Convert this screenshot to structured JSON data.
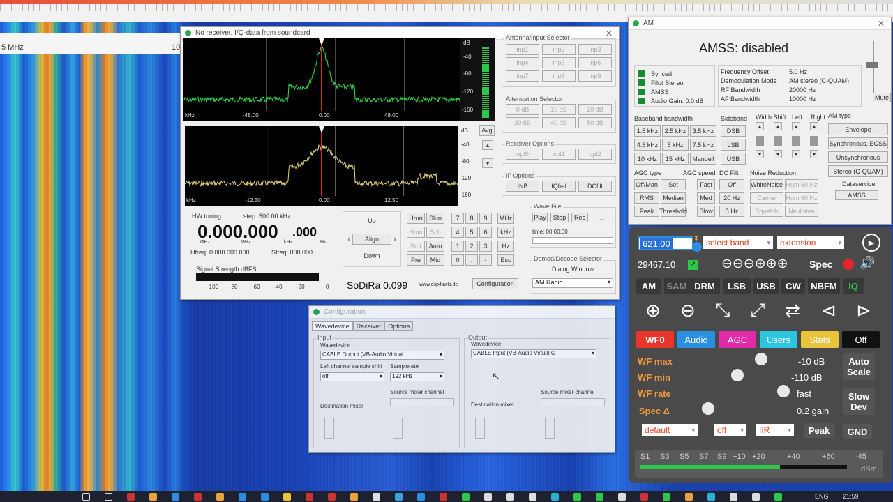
{
  "waterfall": {
    "scale_label": "5 MHz",
    "scale_label_right": "10"
  },
  "receiver": {
    "title": "No receiver, I/Q-data from soundcard",
    "top_spectrum": {
      "unit": "dB",
      "db_ticks": [
        "-40",
        "-80",
        "-120",
        "-160"
      ],
      "x_unit": "kHz",
      "x_ticks": [
        "-48.00",
        "0.00",
        "48.00"
      ]
    },
    "bottom_spectrum": {
      "unit": "dB",
      "db_ticks": [
        "-40",
        "-80",
        "-120",
        "-160"
      ],
      "x_unit": "kHz",
      "x_ticks": [
        "-12.50",
        "0.00",
        "12.50"
      ]
    },
    "avg_label": "Avg",
    "hw_tuning_label": "HW tuning",
    "step_label": "step: 500.00 kHz",
    "frequency_display": "0.000.000",
    "frequency_small": ".000",
    "freq_units": [
      "GHz",
      "MHz",
      "kHz",
      "Hz"
    ],
    "hfreq_label": "Hfreq: 0.000.000.000",
    "sfreq_label": "Sfreq: 000.000",
    "signal_strength_label": "Signal Strength dBFS",
    "signal_ticks": [
      "-100",
      "-80",
      "-60",
      "-40",
      "-20",
      "0"
    ],
    "nav": {
      "up": "Up",
      "align": "Align",
      "down": "Down"
    },
    "mode_buttons": [
      "Hrun",
      "Slun",
      "Hmo",
      "Sch",
      "Smt",
      "Auto",
      "Pre",
      "Mid"
    ],
    "keypad": [
      "7",
      "8",
      "9",
      "MHz",
      "4",
      "5",
      "6",
      "kHz",
      "1",
      "2",
      "3",
      "Hz",
      "0",
      ".",
      "-",
      "Esc"
    ],
    "app_name": "SoDiRa 0.099",
    "website": "www.dsp4swls.de",
    "config_button": "Configuration",
    "antenna_selector": {
      "label": "Antenna/Input Selector",
      "items": [
        "inp1",
        "inp2",
        "inp3",
        "inp4",
        "inp5",
        "inp6",
        "inp7",
        "inp8",
        "inp9"
      ]
    },
    "attenuation_selector": {
      "label": "Attenuation Selector",
      "items": [
        "0 dB",
        "10 dB",
        "20 dB",
        "30 dB",
        "40 dB",
        "50 dB"
      ]
    },
    "receiver_options": {
      "label": "Receiver Options",
      "items": [
        "opt0",
        "opt1",
        "opt2"
      ]
    },
    "if_options": {
      "label": "IF Options",
      "items": [
        "INB",
        "IQbal",
        "DCfilt"
      ]
    },
    "wave_file": {
      "label": "Wave File",
      "play": "Play",
      "stop": "Stop",
      "rec": "Rec",
      "extra": "...",
      "time": "time: 00:00:00"
    },
    "demod_selector": {
      "label": "Demod/Decode Selector",
      "dialog_button": "Dialog Window",
      "selected": "AM Radio"
    }
  },
  "am": {
    "title": "AM",
    "amss_status": "AMSS: disabled",
    "mute_label": "Mute",
    "leds": [
      "Synced",
      "Pilot Stereo",
      "AMSS",
      "Audio Gain: 0.0 dB"
    ],
    "info_labels": [
      "Frequency Offset",
      "Demodulation Mode",
      "RF Bandwidth",
      "AF Bandwidth"
    ],
    "info_values": [
      "5.0 Hz",
      "AM stereo (C-QUAM)",
      "20000 Hz",
      "10000 Hz"
    ],
    "baseband_label": "Baseband bandwidth",
    "baseband_buttons": [
      "1.5 kHz",
      "2.5 kHz",
      "3.5 kHz",
      "4.5 kHz",
      "5 kHz",
      "7.5 kHz",
      "10 kHz",
      "15 kHz",
      "Manuell"
    ],
    "sideband_label": "Sideband",
    "sideband_buttons": [
      "DSB",
      "LSB",
      "USB"
    ],
    "width_shift_label": "Width Shift",
    "left_label": "Left",
    "right_label": "Right",
    "am_type_label": "AM type",
    "am_type_buttons": [
      "Envelope",
      "Synchronous, ECSS",
      "Unsynchronous",
      "Stereo (C-QUAM)"
    ],
    "agc_type_label": "AGC type",
    "agc_type_buttons": [
      "Off/Man",
      "Set",
      "RMS",
      "Median",
      "Peak",
      "Threshold"
    ],
    "agc_speed_label": "AGC speed",
    "agc_speed_buttons": [
      "Fast",
      "Med",
      "Slow"
    ],
    "dc_filt_label": "DC Filt",
    "dc_filt_buttons": [
      "Off",
      "20 Hz",
      "5 Hz"
    ],
    "noise_label": "Noise Reduction",
    "noise_buttons": [
      "WhiteNoise",
      "Hum 50 Hz",
      "Carrier",
      "Hum 60 Hz",
      "Squelch",
      "Neulisten"
    ],
    "dataservice_label": "Dataservice",
    "dataservice_button": "AMSS"
  },
  "config": {
    "title": "Configuration",
    "tabs": [
      "Wavedevice",
      "Receiver",
      "Options"
    ],
    "input_label": "Input",
    "output_label": "Output",
    "wavedevice_label": "Wavedevice",
    "input_device": "CABLE Output (VB-Audio Virtual",
    "output_device": "CABLE Input (VB-Audio Virtual C",
    "left_shift_label": "Left channel sample shift",
    "left_shift_value": "off",
    "samplerate_label": "Samplerate",
    "samplerate_value": "192 kHz",
    "source_mixer_label": "Source mixer channel",
    "dest_mixer_label": "Destination mixer"
  },
  "sdr": {
    "freq_input": "621.00",
    "band_select": "select band",
    "extension_select": "extension",
    "hz_readout": "29467.10",
    "zoom_glyphs": "⊖⊖⊖⊕⊕⊕",
    "spec_label": "Spec",
    "modes": [
      "AM",
      "SAM",
      "DRM",
      "LSB",
      "USB",
      "CW",
      "NBFM",
      "IQ"
    ],
    "tabs": [
      "WF0",
      "Audio",
      "AGC",
      "Users",
      "Stats",
      "Off"
    ],
    "wf_max_label": "WF max",
    "wf_max_value": "-10 dB",
    "wf_min_label": "WF min",
    "wf_min_value": "-110 dB",
    "wf_rate_label": "WF rate",
    "wf_rate_value": "fast",
    "spec_delta_label": "Spec Δ",
    "spec_delta_value": "0.2 gain",
    "auto_scale_label": "Auto Scale",
    "slow_dev_label": "Slow Dev",
    "bottom_selects": [
      "default",
      "off",
      "IIR"
    ],
    "peak_label": "Peak",
    "gnd_label": "GND",
    "s_meter_labels": [
      "S1",
      "S3",
      "S5",
      "S7",
      "S9",
      "+10",
      "+20",
      "+40",
      "+60",
      "-45"
    ],
    "dbm_label": "dBm",
    "colors": {
      "wf0": "#e8362a",
      "audio": "#2a8fe0",
      "agc": "#e02aa8",
      "users": "#2bc6e0",
      "stats": "#e7c43a",
      "off": "#111111"
    }
  },
  "taskbar": {
    "lang": "ENG",
    "time": "21:59"
  }
}
